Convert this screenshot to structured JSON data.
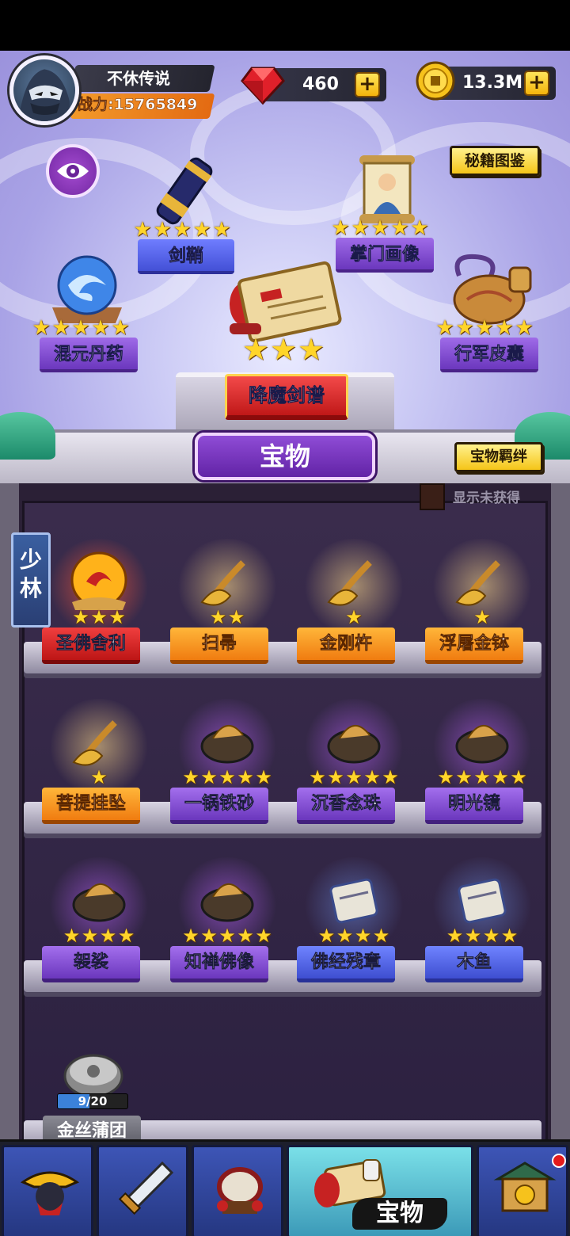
{
  "player": {
    "name": "不休传说",
    "power": "战力:15765849"
  },
  "currency": {
    "gems": "460",
    "gold": "13.3M"
  },
  "buttons": {
    "catalog": "秘籍图鉴",
    "bond": "宝物羁绊",
    "plus": "+"
  },
  "featured": [
    {
      "name": "剑鞘",
      "stars": 5,
      "style": "blue"
    },
    {
      "name": "掌门画像",
      "stars": 5,
      "style": "purple"
    },
    {
      "name": "混元丹药",
      "stars": 5,
      "style": "purple"
    },
    {
      "name": "降魔剑谱",
      "stars": 3,
      "style": "red"
    },
    {
      "name": "行军皮囊",
      "stars": 5,
      "style": "purple"
    }
  ],
  "title": "宝物",
  "filter": {
    "label": "显示未获得",
    "checked": false
  },
  "sect": "少林",
  "shelf_rows": [
    [
      {
        "name": "圣佛舍利",
        "stars": 3,
        "style": "red",
        "glow": "red"
      },
      {
        "name": "扫帚",
        "stars": 2,
        "style": "orange",
        "glow": "gold"
      },
      {
        "name": "金刚杵",
        "stars": 1,
        "style": "orange",
        "glow": "gold"
      },
      {
        "name": "浮屠金钵",
        "stars": 1,
        "style": "orange",
        "glow": "gold"
      }
    ],
    [
      {
        "name": "菩提挂坠",
        "stars": 1,
        "style": "orange",
        "glow": "gold"
      },
      {
        "name": "一锅铁砂",
        "stars": 5,
        "style": "purple",
        "glow": "purple"
      },
      {
        "name": "沉香念珠",
        "stars": 5,
        "style": "purple",
        "glow": "purple"
      },
      {
        "name": "明光镜",
        "stars": 5,
        "style": "purple",
        "glow": "purple"
      }
    ],
    [
      {
        "name": "袈裟",
        "stars": 4,
        "style": "purple",
        "glow": "purple"
      },
      {
        "name": "知禅佛像",
        "stars": 5,
        "style": "purple",
        "glow": "purple"
      },
      {
        "name": "佛经残章",
        "stars": 4,
        "style": "blue",
        "glow": "blue"
      },
      {
        "name": "木鱼",
        "stars": 4,
        "style": "blue",
        "glow": "blue"
      }
    ]
  ],
  "locked_item": {
    "name": "金丝蒲团",
    "progress_text": "9/20",
    "progress": 0.45
  },
  "nav": {
    "active_label": "宝物"
  },
  "colors": {
    "accent": "#7a2fc0",
    "gold": "#f5c518",
    "star": "#ffd52a"
  }
}
